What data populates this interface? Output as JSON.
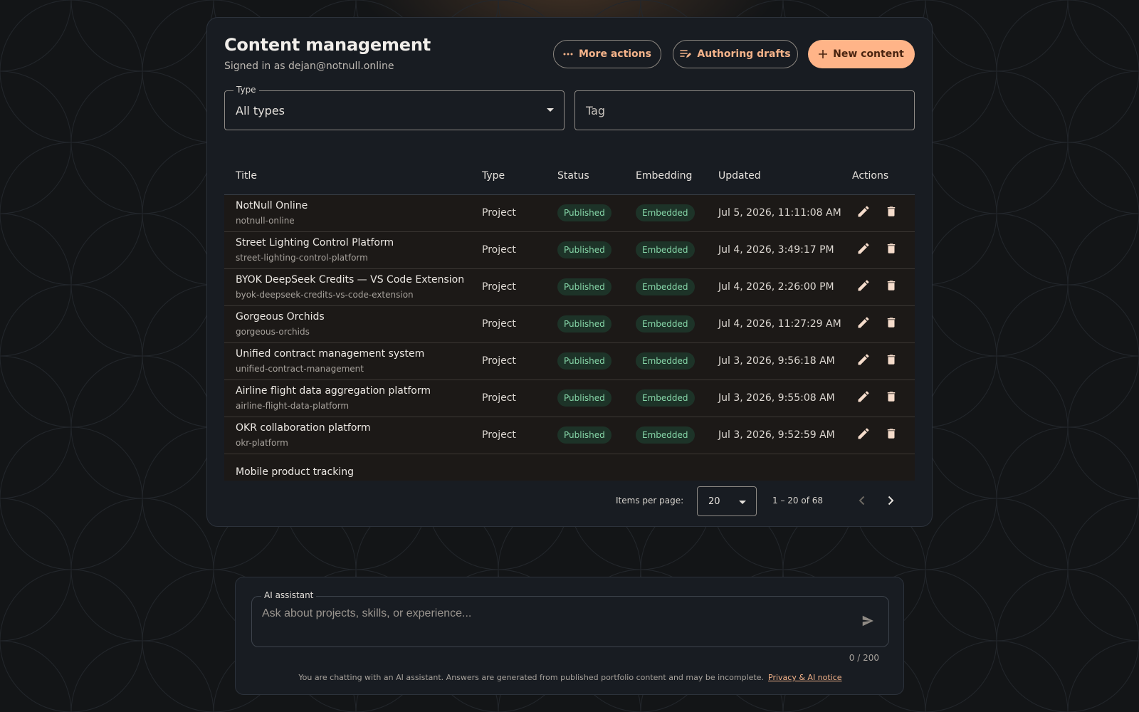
{
  "header": {
    "title": "Content management",
    "signed_in": "Signed in as dejan@notnull.online",
    "more_actions": "More actions",
    "authoring_drafts": "Authoring drafts",
    "new_content": "New content"
  },
  "filters": {
    "type_label": "Type",
    "type_value": "All types",
    "tag_placeholder": "Tag"
  },
  "table": {
    "columns": [
      "Title",
      "Type",
      "Status",
      "Embedding",
      "Updated",
      "Actions"
    ],
    "rows": [
      {
        "title": "NotNull Online",
        "slug": "notnull-online",
        "type": "Project",
        "status": "Published",
        "embedding": "Embedded",
        "updated": "Jul 5, 2026, 11:11:08 AM"
      },
      {
        "title": "Street Lighting Control Platform",
        "slug": "street-lighting-control-platform",
        "type": "Project",
        "status": "Published",
        "embedding": "Embedded",
        "updated": "Jul 4, 2026, 3:49:17 PM"
      },
      {
        "title": "BYOK DeepSeek Credits — VS Code Extension",
        "slug": "byok-deepseek-credits-vs-code-extension",
        "type": "Project",
        "status": "Published",
        "embedding": "Embedded",
        "updated": "Jul 4, 2026, 2:26:00 PM"
      },
      {
        "title": "Gorgeous Orchids",
        "slug": "gorgeous-orchids",
        "type": "Project",
        "status": "Published",
        "embedding": "Embedded",
        "updated": "Jul 4, 2026, 11:27:29 AM"
      },
      {
        "title": "Unified contract management system",
        "slug": "unified-contract-management",
        "type": "Project",
        "status": "Published",
        "embedding": "Embedded",
        "updated": "Jul 3, 2026, 9:56:18 AM"
      },
      {
        "title": "Airline flight data aggregation platform",
        "slug": "airline-flight-data-platform",
        "type": "Project",
        "status": "Published",
        "embedding": "Embedded",
        "updated": "Jul 3, 2026, 9:55:08 AM"
      },
      {
        "title": "OKR collaboration platform",
        "slug": "okr-platform",
        "type": "Project",
        "status": "Published",
        "embedding": "Embedded",
        "updated": "Jul 3, 2026, 9:52:59 AM"
      },
      {
        "title": "Mobile product tracking",
        "slug": "",
        "type": "",
        "status": "",
        "embedding": "",
        "updated": ""
      }
    ]
  },
  "pagination": {
    "label": "Items per page:",
    "per_page": "20",
    "range": "1 – 20 of 68"
  },
  "assistant": {
    "label": "AI assistant",
    "placeholder": "Ask about projects, skills, or experience...",
    "counter": "0 / 200",
    "notice": "You are chatting with an AI assistant. Answers are generated from published portfolio content and may be incomplete.",
    "privacy_link": "Privacy & AI notice"
  },
  "colors": {
    "accent": "#ffb488",
    "panel": "#181c22",
    "row": "#1c1917",
    "pill_bg": "#1d3328",
    "pill_text": "#86d6a8"
  },
  "icons": {
    "more": "more-horiz-icon",
    "drafts": "edit-note-icon",
    "add": "plus-icon",
    "edit": "pencil-icon",
    "delete": "trash-icon",
    "send": "send-icon"
  }
}
